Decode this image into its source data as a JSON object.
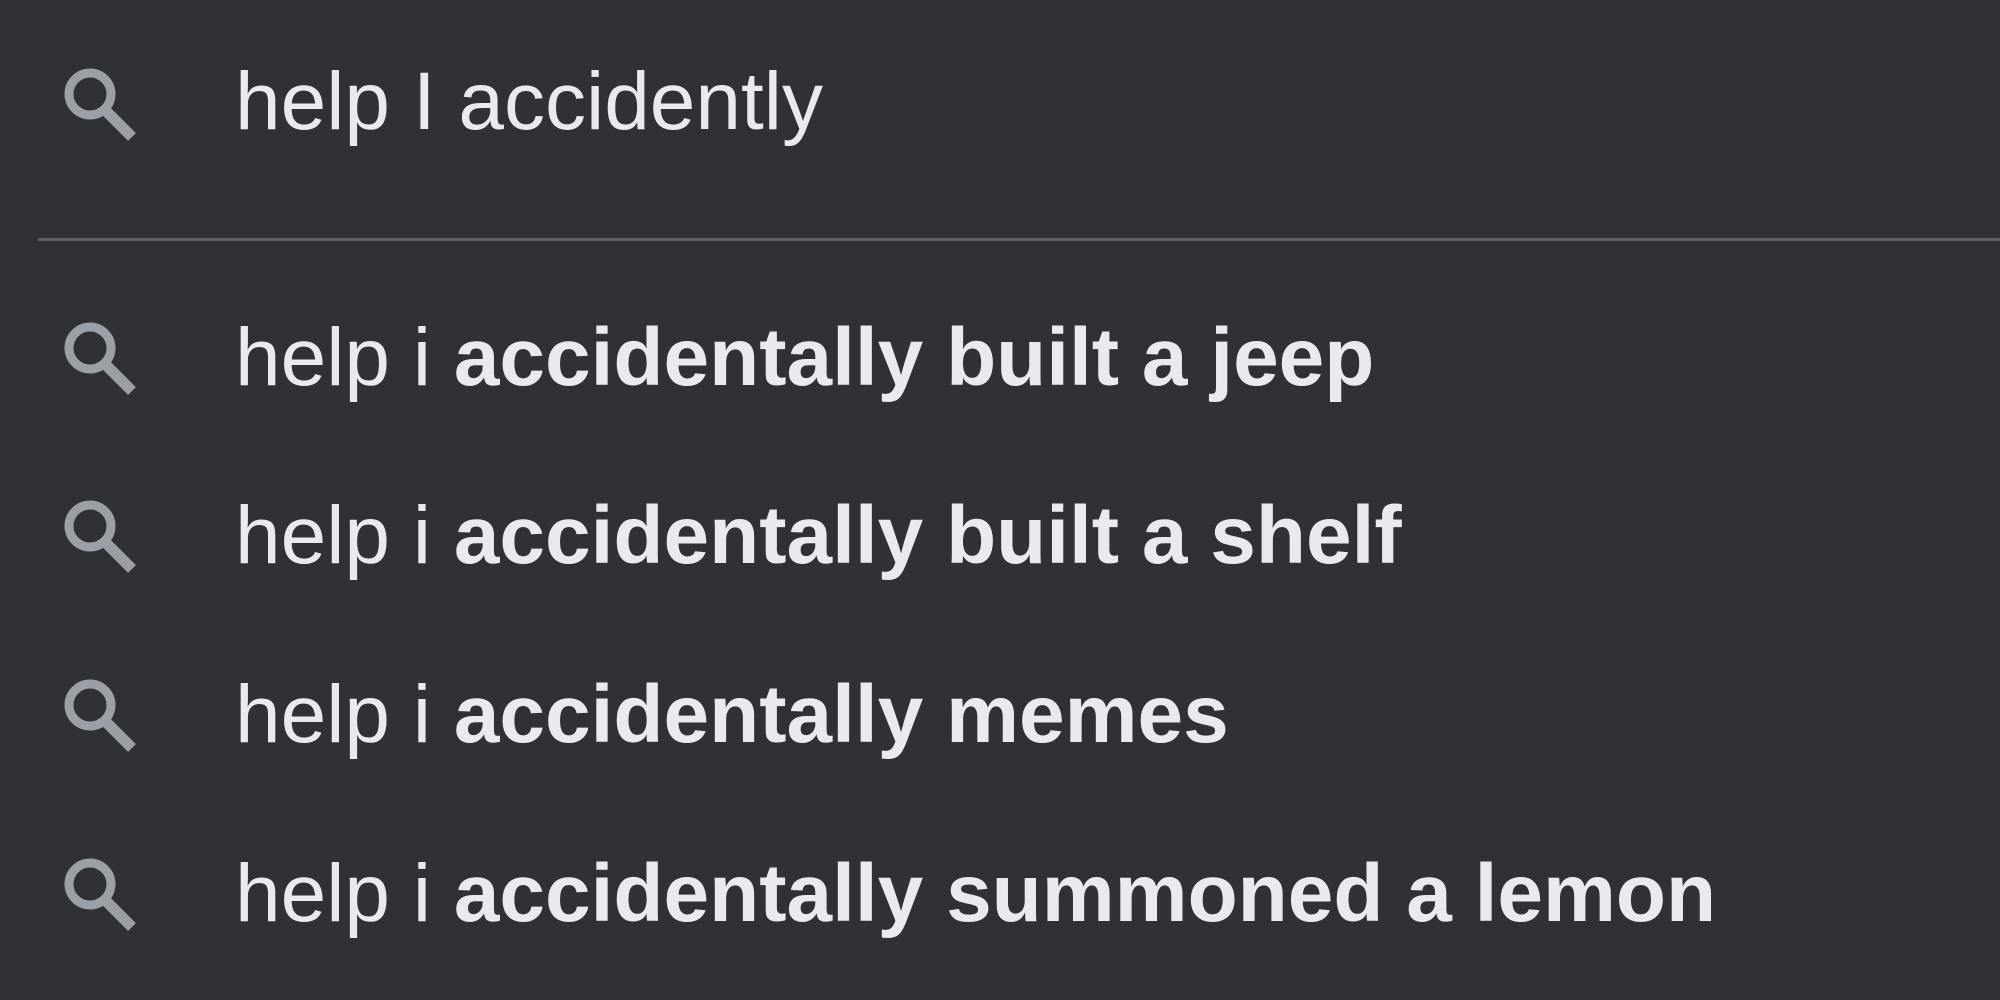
{
  "search": {
    "query": "help I accidently",
    "icon": "search-icon"
  },
  "colors": {
    "background": "#303134",
    "text": "#e8eaed",
    "icon": "#9aa0a6",
    "divider": "#5f6368"
  },
  "suggestions": [
    {
      "prefix": "help i ",
      "completion": "accidentally built a jeep",
      "icon": "search-icon"
    },
    {
      "prefix": "help i ",
      "completion": "accidentally built a shelf",
      "icon": "search-icon"
    },
    {
      "prefix": "help i ",
      "completion": "accidentally memes",
      "icon": "search-icon"
    },
    {
      "prefix": "help i ",
      "completion": "accidentally summoned a lemon",
      "icon": "search-icon"
    }
  ]
}
